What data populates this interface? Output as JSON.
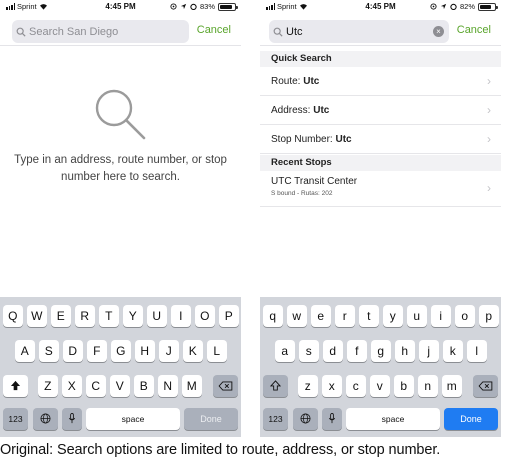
{
  "left_screen": {
    "status": {
      "carrier": "Sprint",
      "time": "4:45 PM",
      "battery": "83%",
      "battery_level": 0.83
    },
    "search": {
      "placeholder": "Search San Diego",
      "value": "",
      "cancel_label": "Cancel"
    },
    "empty_message": "Type in an address, route number, or stop number here to search.",
    "keyboard": {
      "rows": [
        [
          "Q",
          "W",
          "E",
          "R",
          "T",
          "Y",
          "U",
          "I",
          "O",
          "P"
        ],
        [
          "A",
          "S",
          "D",
          "F",
          "G",
          "H",
          "J",
          "K",
          "L"
        ],
        [
          "Z",
          "X",
          "C",
          "V",
          "B",
          "N",
          "M"
        ]
      ],
      "numbers_key": "123",
      "space_key": "space",
      "done_key": "Done",
      "done_enabled": false
    }
  },
  "right_screen": {
    "status": {
      "carrier": "Sprint",
      "time": "4:45 PM",
      "battery": "82%",
      "battery_level": 0.82
    },
    "search": {
      "value": "Utc",
      "cancel_label": "Cancel"
    },
    "quick_search": {
      "header": "Quick Search",
      "items": [
        {
          "label": "Route:",
          "value": "Utc"
        },
        {
          "label": "Address:",
          "value": "Utc"
        },
        {
          "label": "Stop Number:",
          "value": "Utc"
        }
      ]
    },
    "recent_stops": {
      "header": "Recent Stops",
      "items": [
        {
          "name": "UTC Transit Center",
          "detail": "S bound - Rutas: 202"
        }
      ]
    },
    "keyboard": {
      "rows": [
        [
          "q",
          "w",
          "e",
          "r",
          "t",
          "y",
          "u",
          "i",
          "o",
          "p"
        ],
        [
          "a",
          "s",
          "d",
          "f",
          "g",
          "h",
          "j",
          "k",
          "l"
        ],
        [
          "z",
          "x",
          "c",
          "v",
          "b",
          "n",
          "m"
        ]
      ],
      "numbers_key": "123",
      "space_key": "space",
      "done_key": "Done",
      "done_enabled": true
    }
  },
  "caption": "Original: Search options are limited to route, address, or stop number.",
  "colors": {
    "accent_green": "#5aa52c",
    "done_blue": "#1f7cf2",
    "keyboard_bg": "#d2d5db"
  },
  "icons": [
    "search-icon",
    "wifi-icon",
    "location-arrow-icon",
    "alarm-icon",
    "battery-icon",
    "shift-icon",
    "backspace-icon",
    "globe-icon",
    "microphone-icon",
    "chevron-right-icon",
    "clear-icon"
  ]
}
